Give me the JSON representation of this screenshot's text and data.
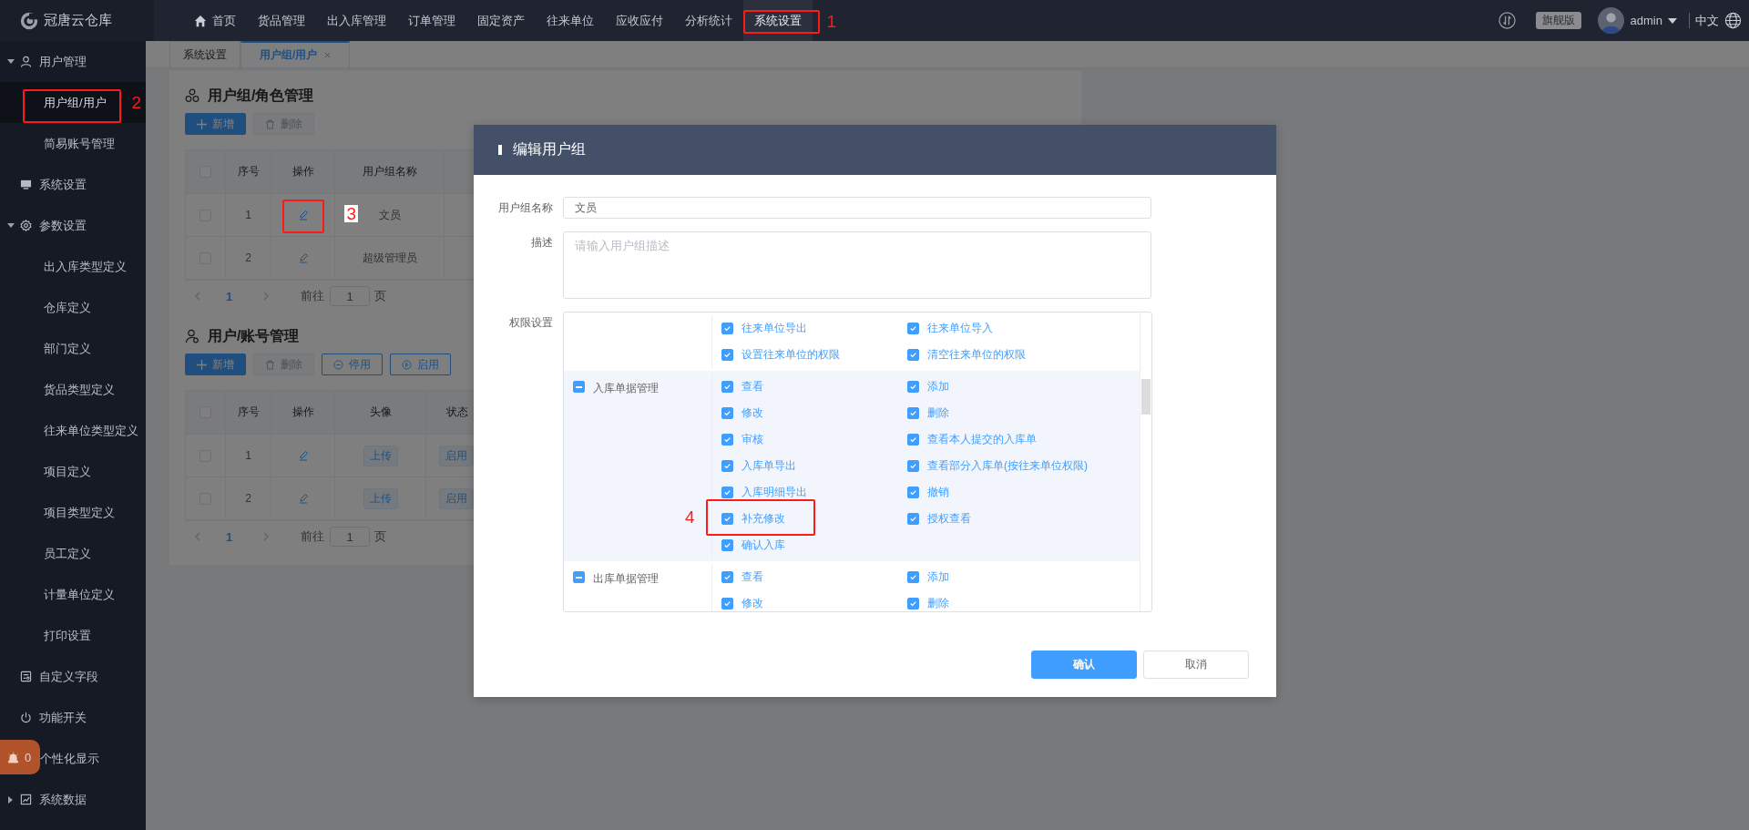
{
  "brand": {
    "name": "冠唐云仓库"
  },
  "top_nav": [
    {
      "label": "首页",
      "selected": false
    },
    {
      "label": "货品管理",
      "selected": false
    },
    {
      "label": "出入库管理",
      "selected": false
    },
    {
      "label": "订单管理",
      "selected": false
    },
    {
      "label": "固定资产",
      "selected": false
    },
    {
      "label": "往来单位",
      "selected": false
    },
    {
      "label": "应收应付",
      "selected": false
    },
    {
      "label": "分析统计",
      "selected": false
    },
    {
      "label": "系统设置",
      "selected": true,
      "annotation": "1"
    }
  ],
  "header_right": {
    "edition": "旗舰版",
    "user": "admin",
    "language": "中文"
  },
  "sidebar": [
    {
      "label": "用户管理",
      "expanded": true,
      "children": [
        {
          "label": "用户组/用户",
          "selected": true,
          "annotation": "2"
        },
        {
          "label": "简易账号管理",
          "selected": false
        }
      ]
    },
    {
      "label": "系统设置"
    },
    {
      "label": "参数设置",
      "expanded": true,
      "children": [
        {
          "label": "出入库类型定义",
          "selected": false
        },
        {
          "label": "仓库定义",
          "selected": false
        },
        {
          "label": "部门定义",
          "selected": false
        },
        {
          "label": "货品类型定义",
          "selected": false
        },
        {
          "label": "往来单位类型定义",
          "selected": false
        },
        {
          "label": "项目定义",
          "selected": false
        },
        {
          "label": "项目类型定义",
          "selected": false
        },
        {
          "label": "员工定义",
          "selected": false
        },
        {
          "label": "计量单位定义",
          "selected": false
        },
        {
          "label": "打印设置",
          "selected": false
        }
      ]
    },
    {
      "label": "自定义字段"
    },
    {
      "label": "功能开关"
    },
    {
      "label": "个性化显示"
    },
    {
      "label": "系统数据",
      "expanded": false
    }
  ],
  "notification_badge": {
    "count": "0"
  },
  "tabs": [
    {
      "label": "系统设置",
      "selected": false,
      "closable": false
    },
    {
      "label": "用户组/用户",
      "selected": true,
      "closable": true
    }
  ],
  "role_panel": {
    "title": "用户组/角色管理",
    "buttons": [
      {
        "label": "新增",
        "kind": "primary",
        "disabled": false
      },
      {
        "label": "删除",
        "kind": "plain",
        "disabled": true
      }
    ],
    "table": {
      "all_checked": false,
      "columns": [
        "序号",
        "操作",
        "用户组名称"
      ],
      "rows": [
        {
          "checked": false,
          "index": "1",
          "name": "文员",
          "annotation": "3"
        },
        {
          "checked": false,
          "index": "2",
          "name": "超级管理员"
        }
      ]
    },
    "pagination": {
      "page": "1",
      "goto_label": "前往",
      "goto_value": "1",
      "page_suffix": "页"
    }
  },
  "user_panel": {
    "title": "用户/账号管理",
    "buttons": [
      {
        "label": "新增",
        "kind": "primary",
        "disabled": false
      },
      {
        "label": "删除",
        "kind": "plain",
        "disabled": true
      },
      {
        "label": "停用",
        "kind": "outline",
        "disabled": false
      },
      {
        "label": "启用",
        "kind": "outline",
        "disabled": false
      }
    ],
    "table": {
      "all_checked": false,
      "columns": [
        "序号",
        "操作",
        "头像",
        "状态"
      ],
      "rows": [
        {
          "checked": false,
          "index": "1",
          "avatar_action": "上传",
          "status": "启用"
        },
        {
          "checked": false,
          "index": "2",
          "avatar_action": "上传",
          "status": "启用"
        }
      ]
    },
    "pagination": {
      "page": "1",
      "goto_label": "前往",
      "goto_value": "1",
      "page_suffix": "页"
    }
  },
  "dialog": {
    "title": "编辑用户组",
    "fields": [
      {
        "label": "用户组名称",
        "kind": "input",
        "value": "文员"
      },
      {
        "label": "描述",
        "kind": "textarea",
        "placeholder": "请输入用户组描述"
      }
    ],
    "permissions": {
      "label": "权限设置",
      "groups": [
        {
          "highlighted": false,
          "items": [
            {
              "label": "往来单位导出",
              "checked": true
            },
            {
              "label": "往来单位导入",
              "checked": true
            },
            {
              "label": "设置往来单位的权限",
              "checked": true
            },
            {
              "label": "清空往来单位的权限",
              "checked": true
            }
          ]
        },
        {
          "name": "入库单据管理",
          "indeterminate": true,
          "highlighted": true,
          "items": [
            {
              "label": "查看",
              "checked": true
            },
            {
              "label": "添加",
              "checked": true
            },
            {
              "label": "修改",
              "checked": true
            },
            {
              "label": "删除",
              "checked": true
            },
            {
              "label": "审核",
              "checked": true
            },
            {
              "label": "查看本人提交的入库单",
              "checked": true
            },
            {
              "label": "入库单导出",
              "checked": true
            },
            {
              "label": "查看部分入库单(按往来单位权限)",
              "checked": true
            },
            {
              "label": "入库明细导出",
              "checked": true
            },
            {
              "label": "撤销",
              "checked": true
            },
            {
              "label": "补充修改",
              "checked": true,
              "annotation": "4"
            },
            {
              "label": "授权查看",
              "checked": true
            },
            {
              "label": "确认入库",
              "checked": true
            }
          ]
        },
        {
          "name": "出库单据管理",
          "indeterminate": true,
          "highlighted": false,
          "items": [
            {
              "label": "查看",
              "checked": true
            },
            {
              "label": "添加",
              "checked": true
            },
            {
              "label": "修改",
              "checked": true
            },
            {
              "label": "删除",
              "checked": true
            }
          ]
        }
      ]
    },
    "buttons": [
      {
        "label": "确认",
        "kind": "primary"
      },
      {
        "label": "取消",
        "kind": "plain"
      }
    ]
  }
}
